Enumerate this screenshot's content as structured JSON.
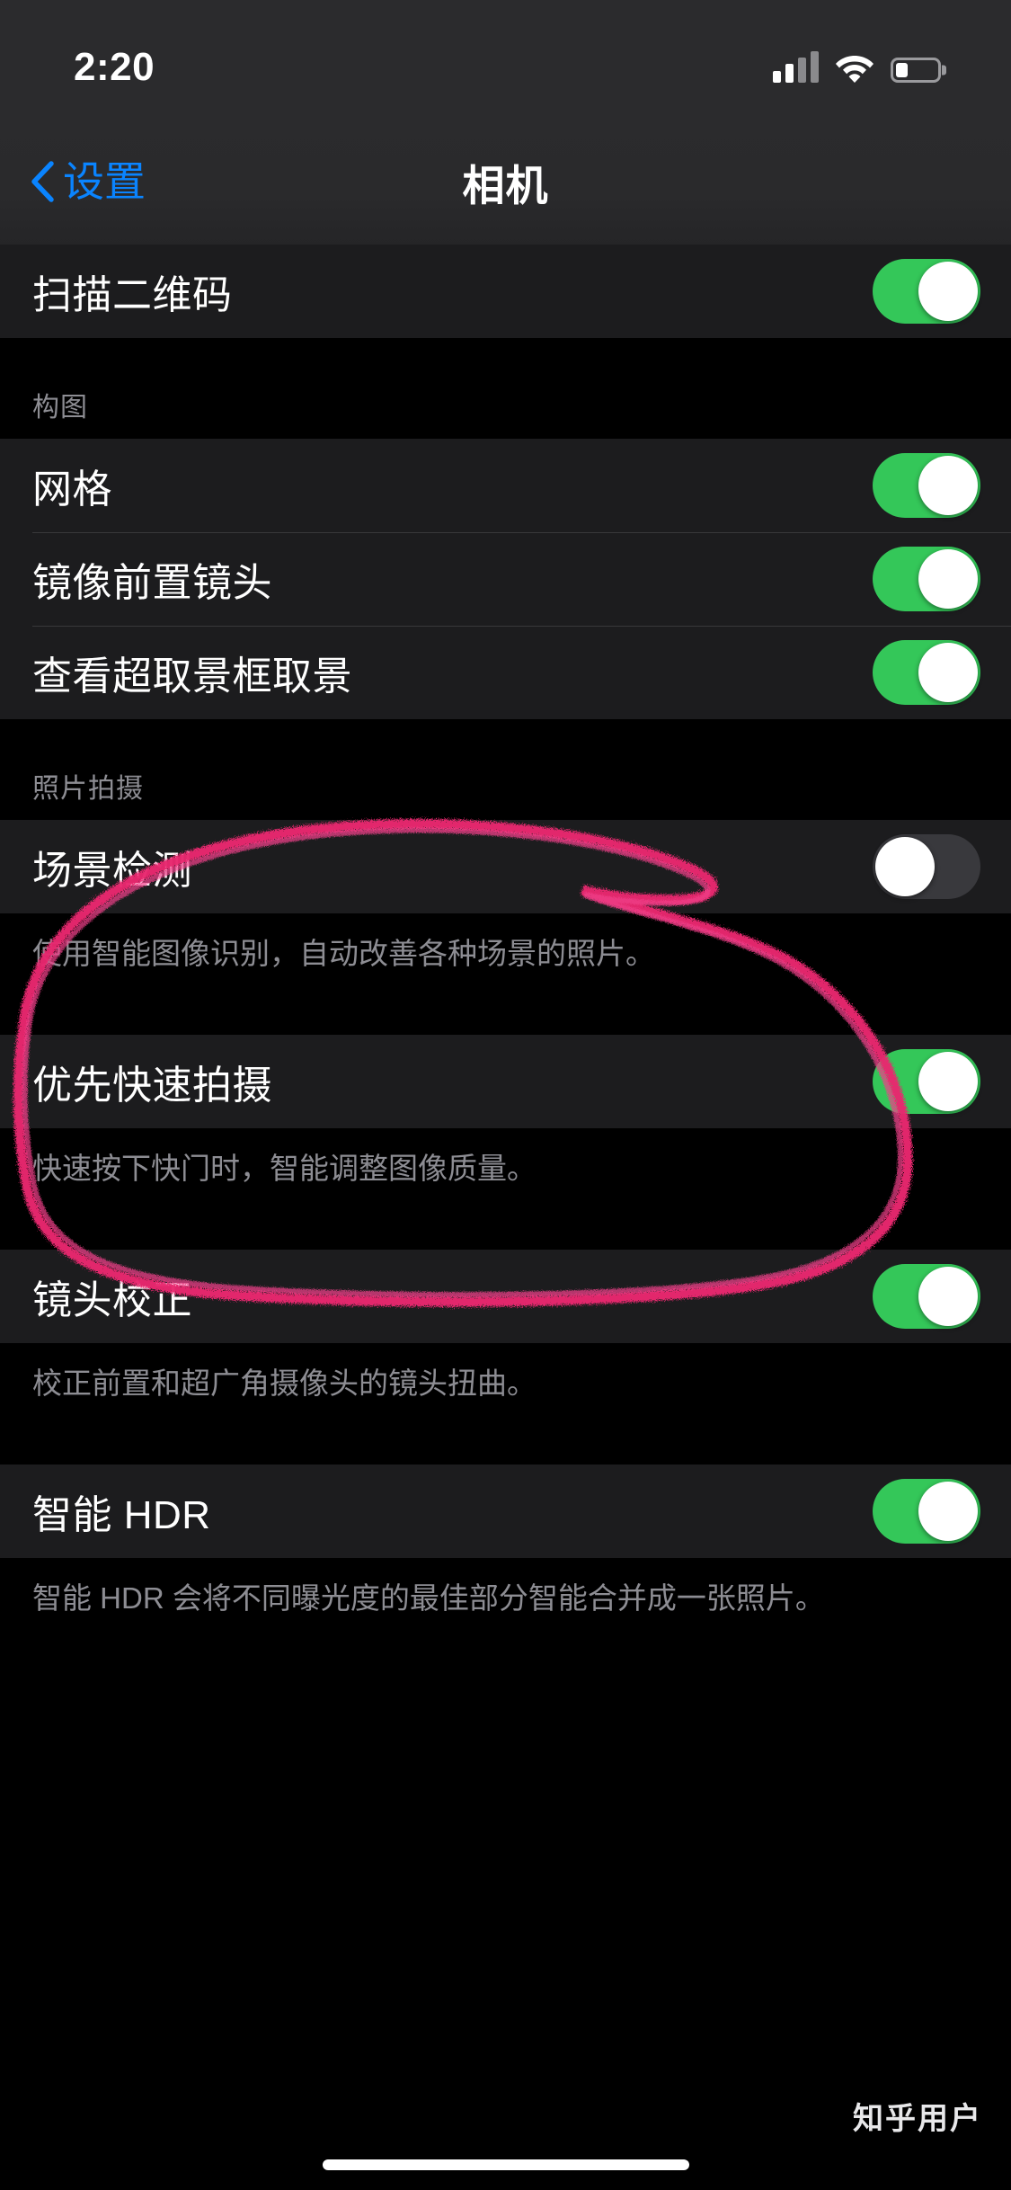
{
  "status_bar": {
    "time": "2:20",
    "signal_icon": "cellular-signal-icon",
    "signal_bars_filled": 2,
    "signal_bars_total": 4,
    "wifi_icon": "wifi-icon",
    "battery_icon": "battery-icon",
    "battery_level_percent": 30
  },
  "nav": {
    "back_icon": "chevron-left-icon",
    "back_label": "设置",
    "title": "相机"
  },
  "colors": {
    "toggle_on": "#34c759",
    "toggle_off": "#39393d",
    "accent_blue": "#0a84ff",
    "row_background": "#1c1c1e",
    "page_background": "#000000",
    "annotation_pink": "#e8276e",
    "secondary_text": "#8d8d93"
  },
  "sections": [
    {
      "header": "",
      "rows": [
        {
          "label": "扫描二维码",
          "control": "switch",
          "value": "on"
        }
      ],
      "footer": ""
    },
    {
      "header": "构图",
      "rows": [
        {
          "label": "网格",
          "control": "switch",
          "value": "on"
        },
        {
          "label": "镜像前置镜头",
          "control": "switch",
          "value": "on"
        },
        {
          "label": "查看超取景框取景",
          "control": "switch",
          "value": "on"
        }
      ],
      "footer": ""
    },
    {
      "header": "照片拍摄",
      "rows": [
        {
          "label": "场景检测",
          "control": "switch",
          "value": "off"
        }
      ],
      "footer": "使用智能图像识别，自动改善各种场景的照片。"
    },
    {
      "header": "",
      "rows": [
        {
          "label": "优先快速拍摄",
          "control": "switch",
          "value": "on"
        }
      ],
      "footer": "快速按下快门时，智能调整图像质量。"
    },
    {
      "header": "",
      "rows": [
        {
          "label": "镜头校正",
          "control": "switch",
          "value": "on"
        }
      ],
      "footer": "校正前置和超广角摄像头的镜头扭曲。"
    },
    {
      "header": "",
      "rows": [
        {
          "label": "智能 HDR",
          "control": "switch",
          "value": "on"
        }
      ],
      "footer": "智能 HDR 会将不同曝光度的最佳部分智能合并成一张照片。"
    }
  ],
  "annotation": {
    "type": "hand-drawn-ellipse",
    "color": "#e8276e",
    "encircles": "照片拍摄 / 场景检测"
  },
  "watermark": "知乎用户",
  "home_indicator": "home-indicator"
}
